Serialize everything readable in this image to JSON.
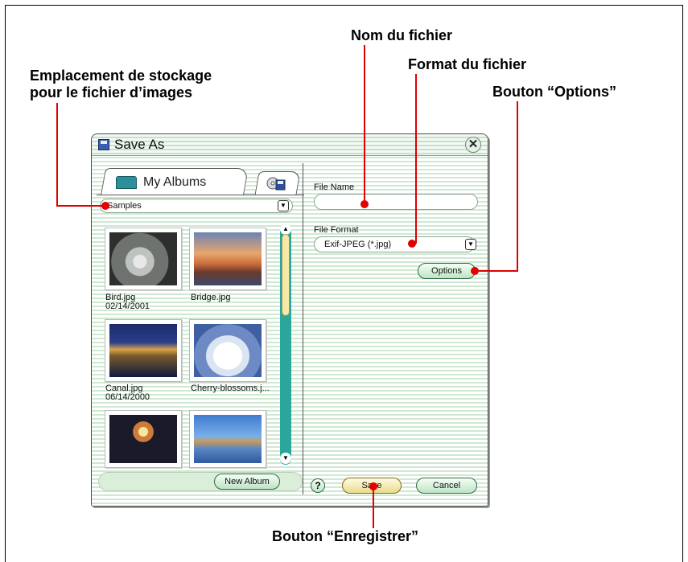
{
  "callouts": {
    "storage": "Emplacement de stockage\npour le fichier d’images",
    "file_name": "Nom du fichier",
    "file_format": "Format du fichier",
    "options_button": "Bouton “Options”",
    "save_button": "Bouton “Enregistrer”"
  },
  "dialog": {
    "title": "Save As",
    "close_label": "✕",
    "tabs": {
      "albums_label": "My Albums"
    },
    "album_select": {
      "value": "Samples"
    },
    "thumbnails": [
      {
        "name": "Bird.jpg",
        "date": "02/14/2001"
      },
      {
        "name": "Bridge.jpg",
        "date": ""
      },
      {
        "name": "Canal.jpg",
        "date": "06/14/2000"
      },
      {
        "name": "Cherry-blossoms.j...",
        "date": ""
      },
      {
        "name": "",
        "date": ""
      },
      {
        "name": "",
        "date": ""
      }
    ],
    "new_album_label": "New Album",
    "file_name_label": "File Name",
    "file_name_value": "",
    "file_format_label": "File Format",
    "file_format_value": "Exif-JPEG (*.jpg)",
    "options_label": "Options",
    "help_label": "?",
    "save_label": "Save",
    "cancel_label": "Cancel"
  },
  "colors": {
    "dialog_stripe": "#cfe8d2",
    "scrollbar": "#2aa79a",
    "callout_dot": "#e00000"
  }
}
